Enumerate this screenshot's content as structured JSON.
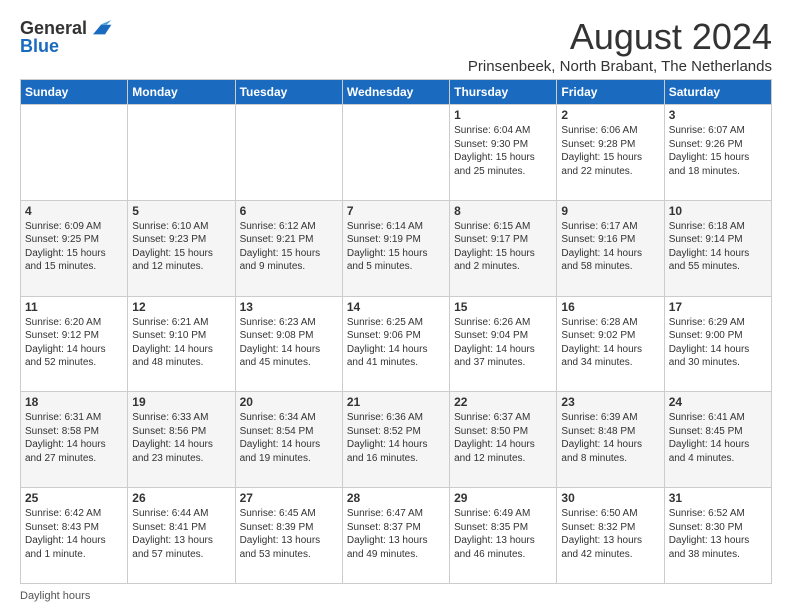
{
  "logo": {
    "general": "General",
    "blue": "Blue"
  },
  "title": "August 2024",
  "subtitle": "Prinsenbeek, North Brabant, The Netherlands",
  "days_header": [
    "Sunday",
    "Monday",
    "Tuesday",
    "Wednesday",
    "Thursday",
    "Friday",
    "Saturday"
  ],
  "footer_label": "Daylight hours",
  "weeks": [
    [
      {
        "num": "",
        "info": ""
      },
      {
        "num": "",
        "info": ""
      },
      {
        "num": "",
        "info": ""
      },
      {
        "num": "",
        "info": ""
      },
      {
        "num": "1",
        "info": "Sunrise: 6:04 AM\nSunset: 9:30 PM\nDaylight: 15 hours and 25 minutes."
      },
      {
        "num": "2",
        "info": "Sunrise: 6:06 AM\nSunset: 9:28 PM\nDaylight: 15 hours and 22 minutes."
      },
      {
        "num": "3",
        "info": "Sunrise: 6:07 AM\nSunset: 9:26 PM\nDaylight: 15 hours and 18 minutes."
      }
    ],
    [
      {
        "num": "4",
        "info": "Sunrise: 6:09 AM\nSunset: 9:25 PM\nDaylight: 15 hours and 15 minutes."
      },
      {
        "num": "5",
        "info": "Sunrise: 6:10 AM\nSunset: 9:23 PM\nDaylight: 15 hours and 12 minutes."
      },
      {
        "num": "6",
        "info": "Sunrise: 6:12 AM\nSunset: 9:21 PM\nDaylight: 15 hours and 9 minutes."
      },
      {
        "num": "7",
        "info": "Sunrise: 6:14 AM\nSunset: 9:19 PM\nDaylight: 15 hours and 5 minutes."
      },
      {
        "num": "8",
        "info": "Sunrise: 6:15 AM\nSunset: 9:17 PM\nDaylight: 15 hours and 2 minutes."
      },
      {
        "num": "9",
        "info": "Sunrise: 6:17 AM\nSunset: 9:16 PM\nDaylight: 14 hours and 58 minutes."
      },
      {
        "num": "10",
        "info": "Sunrise: 6:18 AM\nSunset: 9:14 PM\nDaylight: 14 hours and 55 minutes."
      }
    ],
    [
      {
        "num": "11",
        "info": "Sunrise: 6:20 AM\nSunset: 9:12 PM\nDaylight: 14 hours and 52 minutes."
      },
      {
        "num": "12",
        "info": "Sunrise: 6:21 AM\nSunset: 9:10 PM\nDaylight: 14 hours and 48 minutes."
      },
      {
        "num": "13",
        "info": "Sunrise: 6:23 AM\nSunset: 9:08 PM\nDaylight: 14 hours and 45 minutes."
      },
      {
        "num": "14",
        "info": "Sunrise: 6:25 AM\nSunset: 9:06 PM\nDaylight: 14 hours and 41 minutes."
      },
      {
        "num": "15",
        "info": "Sunrise: 6:26 AM\nSunset: 9:04 PM\nDaylight: 14 hours and 37 minutes."
      },
      {
        "num": "16",
        "info": "Sunrise: 6:28 AM\nSunset: 9:02 PM\nDaylight: 14 hours and 34 minutes."
      },
      {
        "num": "17",
        "info": "Sunrise: 6:29 AM\nSunset: 9:00 PM\nDaylight: 14 hours and 30 minutes."
      }
    ],
    [
      {
        "num": "18",
        "info": "Sunrise: 6:31 AM\nSunset: 8:58 PM\nDaylight: 14 hours and 27 minutes."
      },
      {
        "num": "19",
        "info": "Sunrise: 6:33 AM\nSunset: 8:56 PM\nDaylight: 14 hours and 23 minutes."
      },
      {
        "num": "20",
        "info": "Sunrise: 6:34 AM\nSunset: 8:54 PM\nDaylight: 14 hours and 19 minutes."
      },
      {
        "num": "21",
        "info": "Sunrise: 6:36 AM\nSunset: 8:52 PM\nDaylight: 14 hours and 16 minutes."
      },
      {
        "num": "22",
        "info": "Sunrise: 6:37 AM\nSunset: 8:50 PM\nDaylight: 14 hours and 12 minutes."
      },
      {
        "num": "23",
        "info": "Sunrise: 6:39 AM\nSunset: 8:48 PM\nDaylight: 14 hours and 8 minutes."
      },
      {
        "num": "24",
        "info": "Sunrise: 6:41 AM\nSunset: 8:45 PM\nDaylight: 14 hours and 4 minutes."
      }
    ],
    [
      {
        "num": "25",
        "info": "Sunrise: 6:42 AM\nSunset: 8:43 PM\nDaylight: 14 hours and 1 minute."
      },
      {
        "num": "26",
        "info": "Sunrise: 6:44 AM\nSunset: 8:41 PM\nDaylight: 13 hours and 57 minutes."
      },
      {
        "num": "27",
        "info": "Sunrise: 6:45 AM\nSunset: 8:39 PM\nDaylight: 13 hours and 53 minutes."
      },
      {
        "num": "28",
        "info": "Sunrise: 6:47 AM\nSunset: 8:37 PM\nDaylight: 13 hours and 49 minutes."
      },
      {
        "num": "29",
        "info": "Sunrise: 6:49 AM\nSunset: 8:35 PM\nDaylight: 13 hours and 46 minutes."
      },
      {
        "num": "30",
        "info": "Sunrise: 6:50 AM\nSunset: 8:32 PM\nDaylight: 13 hours and 42 minutes."
      },
      {
        "num": "31",
        "info": "Sunrise: 6:52 AM\nSunset: 8:30 PM\nDaylight: 13 hours and 38 minutes."
      }
    ]
  ]
}
